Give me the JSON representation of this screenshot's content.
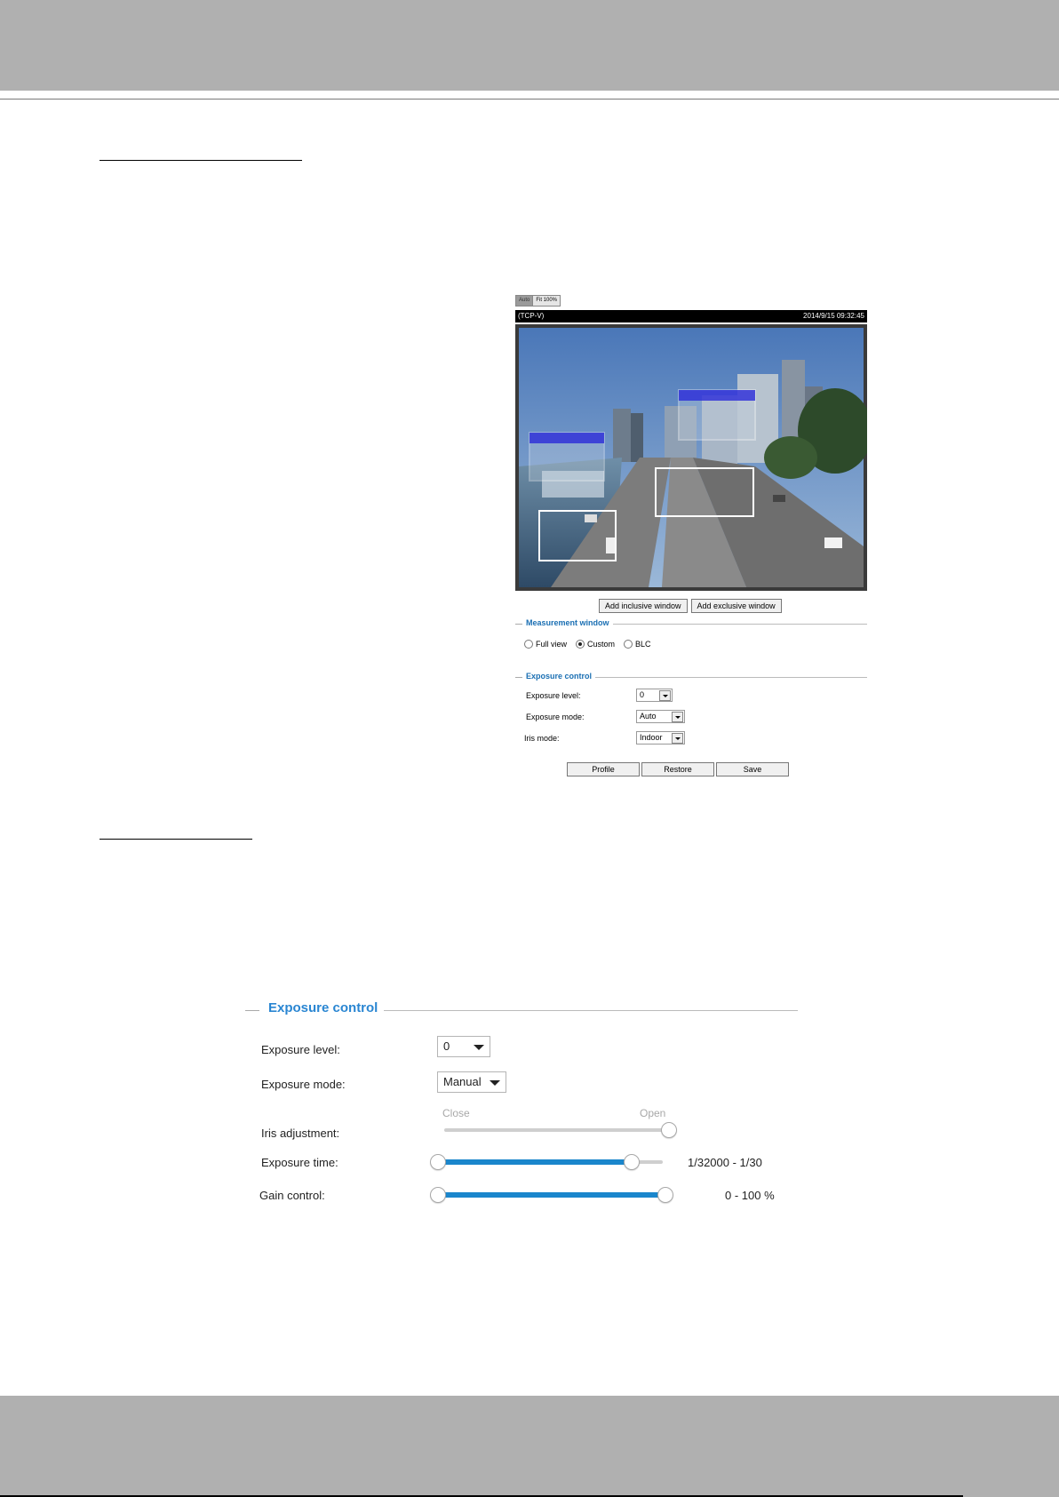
{
  "camera_panel": {
    "view_buttons": [
      "Auto",
      "Fit 100%"
    ],
    "stream_label": "(TCP-V)",
    "timestamp": "2014/9/15 09:32:45",
    "add_inclusive_label": "Add inclusive window",
    "add_exclusive_label": "Add exclusive window",
    "measurement_legend": "Measurement window",
    "radio_options": [
      "Full view",
      "Custom",
      "BLC"
    ],
    "radio_selected": "Custom",
    "exposure_legend": "Exposure control",
    "exposure_level_label": "Exposure level:",
    "exposure_level_value": "0",
    "exposure_mode_label": "Exposure mode:",
    "exposure_mode_value": "Auto",
    "iris_mode_label": "Iris mode:",
    "iris_mode_value": "Indoor",
    "profile_label": "Profile",
    "restore_label": "Restore",
    "save_label": "Save"
  },
  "exposure_panel": {
    "legend": "Exposure control",
    "exposure_level_label": "Exposure level:",
    "exposure_level_value": "0",
    "exposure_mode_label": "Exposure mode:",
    "exposure_mode_value": "Manual",
    "iris_label": "Iris adjustment:",
    "iris_close": "Close",
    "iris_open": "Open",
    "iris_level": 1.0,
    "exposure_time_label": "Exposure time:",
    "exposure_time_range": "1/32000 - 1/30",
    "exposure_time_fill": 0.86,
    "gain_label": "Gain control:",
    "gain_range": "0 - 100 %",
    "gain_fill": 1.0
  },
  "colors": {
    "accent_blue": "#2a86d2",
    "slider_fill": "#1a86cc",
    "header_gray": "#b0b0b0"
  }
}
